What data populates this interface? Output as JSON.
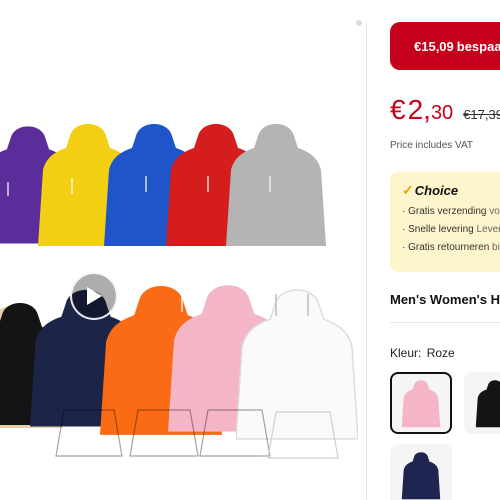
{
  "gallery": {
    "image_alt": "Men's Women's Hoodies in multiple colors",
    "play_icon": "play-icon"
  },
  "price_panel": {
    "savings_amount": "€15,09",
    "savings_label": "bespaard (",
    "price_currency": "€",
    "price_integer": "2,",
    "price_decimal": "30",
    "original_price": "€17,39",
    "vat_note": "Price includes VAT"
  },
  "choice": {
    "icon": "check-icon",
    "title": "Choice",
    "items": [
      {
        "main": "· Gratis verzending",
        "rest": " voor"
      },
      {
        "main": "· Snelle levering",
        "rest": " Leverin"
      },
      {
        "main": "· Gratis retourneren",
        "rest": " bin"
      }
    ]
  },
  "product": {
    "title": "Men's Women's Hoodi"
  },
  "color_selector": {
    "label": "Kleur:",
    "selected": "Roze",
    "options": [
      {
        "name": "Roze",
        "color": "#f4b6c6",
        "selected": true
      },
      {
        "name": "Zwart",
        "color": "#141414",
        "selected": false
      },
      {
        "name": "Navy",
        "color": "#1d2550",
        "selected": false
      }
    ]
  },
  "colors": {
    "accent_red": "#c5001a",
    "choice_bg": "#fff5cc",
    "choice_check": "#f1a400"
  }
}
